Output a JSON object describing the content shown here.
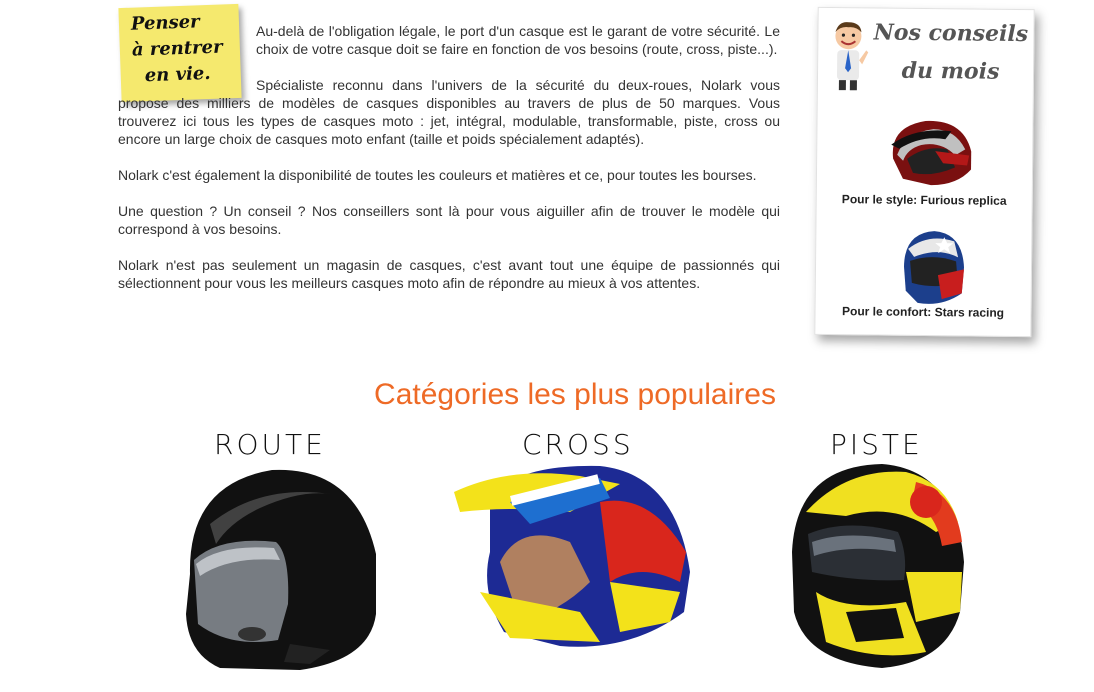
{
  "sticky_note": {
    "lines": [
      "Penser",
      "à rentrer",
      "en vie."
    ]
  },
  "intro": {
    "paragraphs": [
      "Au-delà de l'obligation légale, le port d'un casque est le garant de votre sécurité. Le choix de votre casque doit se faire en fonction de vos besoins (route, cross, piste...).",
      "Spécialiste reconnu dans l'univers de la sécurité du deux-roues, Nolark vous propose des milliers de modèles de casques disponibles au travers de plus de 50 marques. Vous trouverez ici tous les types de casques moto : jet, intégral, modulable, transformable, piste, cross ou encore un large choix de casques moto enfant (taille et poids spécialement adaptés).",
      "Nolark c'est également la disponibilité de toutes les couleurs et matières et ce, pour toutes les bourses.",
      "Une question ? Un conseil ? Nos conseillers sont là pour vous aiguiller afin de trouver le modèle qui correspond à vos besoins.",
      "Nolark n'est pas seulement un magasin de casques, c'est avant tout une équipe de passionnés qui sélectionnent pour vous les meilleurs casques moto afin de répondre au mieux à vos attentes."
    ]
  },
  "advice": {
    "title_line1": "Nos conseils",
    "title_line2": "du mois",
    "items": [
      {
        "caption": "Pour le style: Furious replica",
        "icon": "furious-replica-helmet-icon"
      },
      {
        "caption": "Pour le confort: Stars racing",
        "icon": "stars-racing-helmet-icon"
      }
    ]
  },
  "categories": {
    "title": "Catégories les plus populaires",
    "items": [
      {
        "label": "ROUTE",
        "icon": "route-helmet-icon"
      },
      {
        "label": "CROSS",
        "icon": "cross-helmet-icon"
      },
      {
        "label": "PISTE",
        "icon": "piste-helmet-icon"
      }
    ]
  },
  "colors": {
    "accent": "#ee6a26",
    "sticky": "#f5e96e",
    "text": "#333333"
  }
}
